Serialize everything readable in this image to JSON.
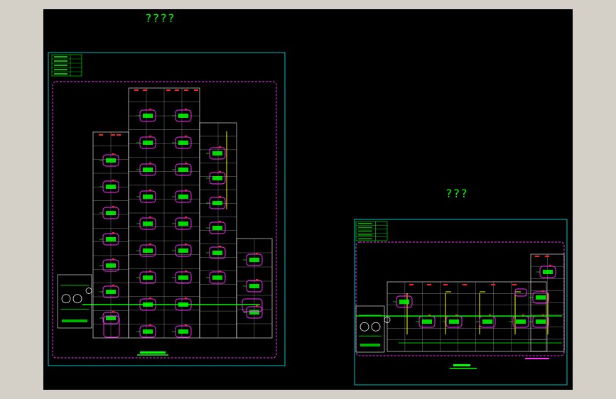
{
  "app": {
    "background": "#d4d0c8",
    "canvas_color": "#000000"
  },
  "sheets": [
    {
      "title": "????",
      "caption_color": "#00ff00"
    },
    {
      "title": "???",
      "caption_color": "#00ff00"
    }
  ],
  "colors": {
    "frame": "#00d8d8",
    "boundary": "#ff33ff",
    "line": "#ffffff",
    "dim_line": "#9a9a9a",
    "pipe": "#00ff00",
    "fixture": "#ff33ff",
    "label": "#00ff00",
    "riser": "#ffff00",
    "annotation": "#ff2020",
    "legend_text": "#00ff00"
  }
}
